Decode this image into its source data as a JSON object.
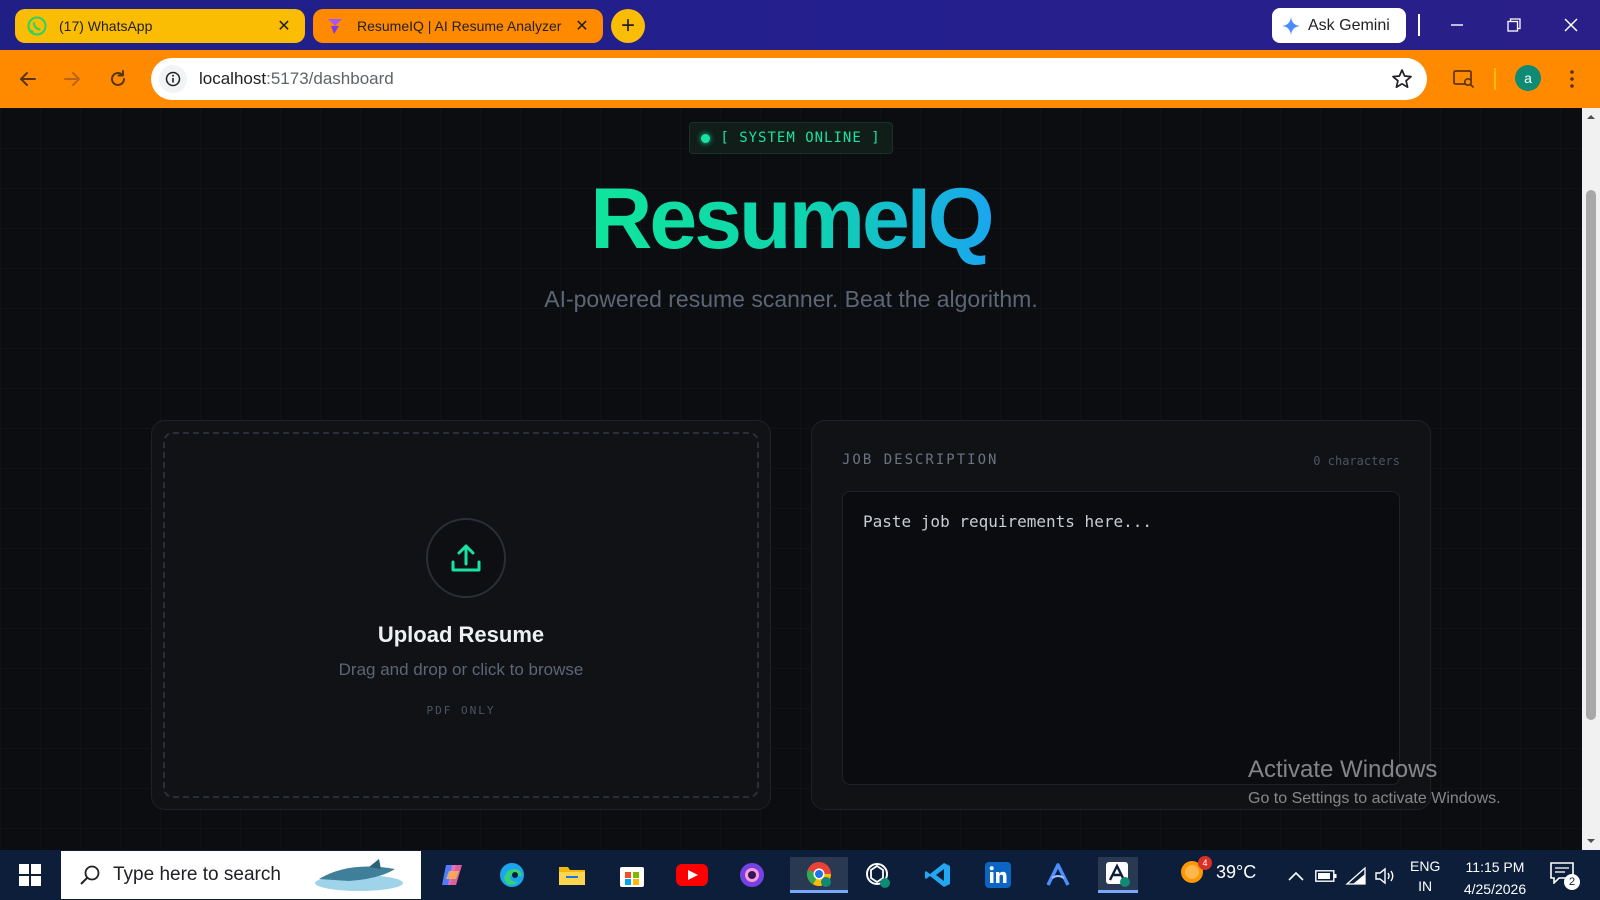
{
  "browser": {
    "tabs": [
      {
        "title": "(17) WhatsApp",
        "icon": "whatsapp-icon",
        "active": false
      },
      {
        "title": "ResumeIQ | AI Resume Analyzer",
        "icon": "resumeiq-favicon-icon",
        "active": true
      }
    ],
    "ask_gemini": "Ask Gemini",
    "url_host": "localhost",
    "url_path": ":5173/dashboard",
    "profile_initial": "a",
    "colors": {
      "tabbar": "#1f1f86",
      "toolbar": "#ff8a00",
      "tab_inactive": "#fbbc04"
    }
  },
  "page": {
    "status": "[ SYSTEM ONLINE ]",
    "brand": "ResumeIQ",
    "tagline": "AI-powered resume scanner. Beat the algorithm.",
    "upload": {
      "title": "Upload Resume",
      "subtitle": "Drag and drop or click to browse",
      "note": "PDF ONLY"
    },
    "job_description": {
      "label": "JOB DESCRIPTION",
      "char_count": "0 characters",
      "placeholder": "Paste job requirements here..."
    },
    "colors": {
      "accent_green": "#19e3a3",
      "accent_blue": "#1aa6ef",
      "background": "#0b0d10",
      "panel": "#101216"
    }
  },
  "watermark": {
    "title": "Activate Windows",
    "subtitle": "Go to Settings to activate Windows."
  },
  "taskbar": {
    "search_placeholder": "Type here to search",
    "apps": [
      "copilot-icon",
      "edge-icon",
      "file-explorer-icon",
      "microsoft-store-icon",
      "youtube-icon",
      "firefox-dev-icon",
      "chrome-icon",
      "chatgpt-icon",
      "vscode-icon",
      "linkedin-icon",
      "arc-icon",
      "app-a-icon"
    ],
    "weather_temp": "39°C",
    "weather_badge": "4",
    "lang_line1": "ENG",
    "lang_line2": "IN",
    "time": "11:15 PM",
    "date": "4/25/2026",
    "notifications": "2"
  }
}
